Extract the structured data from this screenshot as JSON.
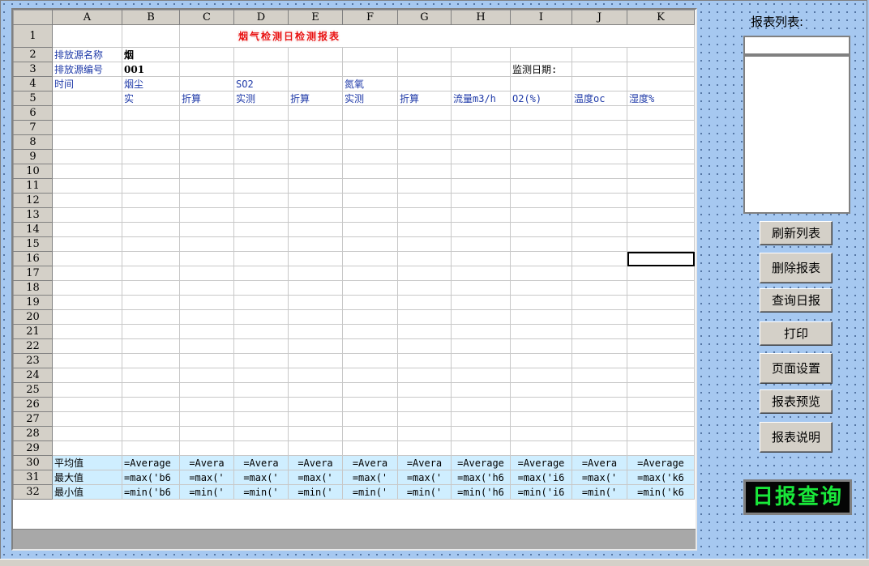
{
  "columns": [
    "",
    "A",
    "B",
    "C",
    "D",
    "E",
    "F",
    "G",
    "H",
    "I",
    "J",
    "K"
  ],
  "sheet_title": "烟气检测日检测报表",
  "rows": {
    "r2": {
      "a": "排放源名称",
      "b": "烟"
    },
    "r3": {
      "a": "排放源编号",
      "b": "001",
      "i": "监测日期:"
    },
    "r4": {
      "a": "时间",
      "b": "烟尘",
      "d": "SO2",
      "f": "氮氧"
    },
    "r5": {
      "b": "实",
      "c": "折算",
      "d": "实测",
      "e": "折算",
      "f": "实测",
      "g": "折算",
      "h": "流量m3/h",
      "i": "O2(%)",
      "j": "温度oc",
      "k": "湿度%"
    },
    "r30": {
      "a": "平均值",
      "b": "=Average",
      "c": "=Avera",
      "d": "=Avera",
      "e": "=Avera",
      "f": "=Avera",
      "g": "=Avera",
      "h": "=Average",
      "i": "=Average",
      "j": "=Avera",
      "k": "=Average"
    },
    "r31": {
      "a": "最大值",
      "b": "=max('b6",
      "c": "=max('",
      "d": "=max('",
      "e": "=max('",
      "f": "=max('",
      "g": "=max('",
      "h": "=max('h6",
      "i": "=max('i6",
      "j": "=max('",
      "k": "=max('k6"
    },
    "r32": {
      "a": "最小值",
      "b": "=min('b6",
      "c": "=min('",
      "d": "=min('",
      "e": "=min('",
      "f": "=min('",
      "g": "=min('",
      "h": "=min('h6",
      "i": "=min('i6",
      "j": "=min('",
      "k": "=min('k6"
    }
  },
  "sidebar": {
    "list_label": "报表列表:",
    "input_value": "",
    "buttons": {
      "refresh": "刷新列表",
      "delete": "删除报表",
      "query": "查询日报",
      "print": "打印",
      "page_setup": "页面设置",
      "preview": "报表预览",
      "help": "报表说明"
    },
    "daily_query": "日报查询"
  },
  "colors": {
    "title": "#e81010",
    "stat_row_bg": "#cfeeff",
    "label_blue": "#1f3aa8",
    "daily_text": "#19e83a"
  }
}
